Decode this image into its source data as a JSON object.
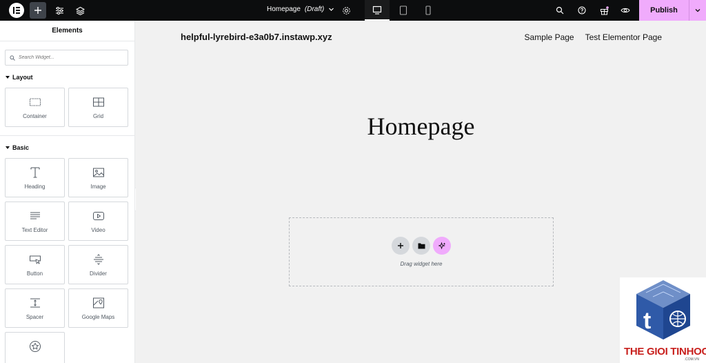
{
  "topbar": {
    "doc_name": "Homepage",
    "doc_status": "(Draft)",
    "publish_label": "Publish",
    "devices": [
      "desktop",
      "tablet",
      "mobile"
    ],
    "accent_color": "#f0abfc"
  },
  "panel": {
    "title": "Elements",
    "search_placeholder": "Search Widget...",
    "categories": [
      {
        "label": "Layout",
        "widgets": [
          {
            "label": "Container",
            "icon": "container-icon"
          },
          {
            "label": "Grid",
            "icon": "grid-icon"
          }
        ]
      },
      {
        "label": "Basic",
        "widgets": [
          {
            "label": "Heading",
            "icon": "heading-icon"
          },
          {
            "label": "Image",
            "icon": "image-icon"
          },
          {
            "label": "Text Editor",
            "icon": "text-editor-icon"
          },
          {
            "label": "Video",
            "icon": "video-icon"
          },
          {
            "label": "Button",
            "icon": "button-icon"
          },
          {
            "label": "Divider",
            "icon": "divider-icon"
          },
          {
            "label": "Spacer",
            "icon": "spacer-icon"
          },
          {
            "label": "Google Maps",
            "icon": "map-icon"
          },
          {
            "label": "",
            "icon": "star-icon"
          }
        ]
      }
    ]
  },
  "canvas": {
    "site_title": "helpful-lyrebird-e3a0b7.instawp.xyz",
    "menu": [
      "Sample Page",
      "Test Elementor Page"
    ],
    "page_heading": "Homepage",
    "dropzone_text": "Drag widget here"
  },
  "watermark": {
    "text": "THE GIOI TINHOC",
    "sub": ".COM.VN"
  }
}
